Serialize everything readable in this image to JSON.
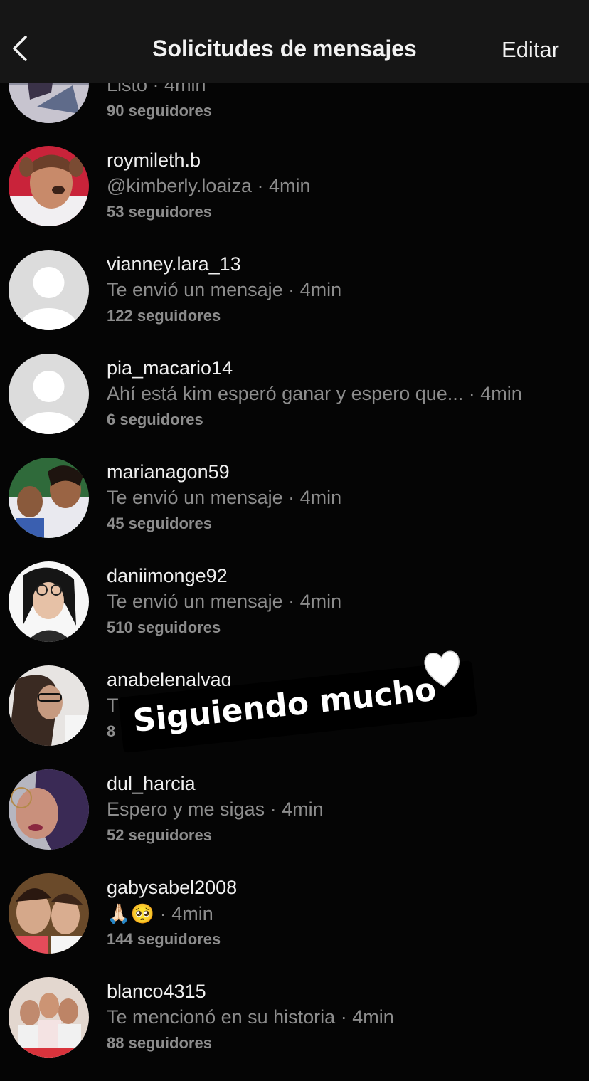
{
  "header": {
    "title": "Solicitudes de mensajes",
    "edit_label": "Editar"
  },
  "requests": [
    {
      "username": "",
      "message": "Listo",
      "time": "4min",
      "followers": "90 seguidores"
    },
    {
      "username": "roymileth.b",
      "message": "@kimberly.loaiza",
      "time": "4min",
      "followers": "53 seguidores"
    },
    {
      "username": "vianney.lara_13",
      "message": "Te envió un mensaje",
      "time": "4min",
      "followers": "122 seguidores"
    },
    {
      "username": "pia_macario14",
      "message": "Ahí está kim esperó ganar y espero que...",
      "time": "4min",
      "followers": "6 seguidores"
    },
    {
      "username": "marianagon59",
      "message": "Te envió un mensaje",
      "time": "4min",
      "followers": "45 seguidores"
    },
    {
      "username": "daniimonge92",
      "message": "Te envió un mensaje",
      "time": "4min",
      "followers": "510 seguidores"
    },
    {
      "username": "anabelenalvag",
      "message": "T",
      "time": "",
      "followers": "8"
    },
    {
      "username": "dul_harcia",
      "message": "Espero y me sigas",
      "time": "4min",
      "followers": "52 seguidores"
    },
    {
      "username": "gabysabel2008",
      "message": "🙏🏻🥺",
      "time": "4min",
      "followers": "144 seguidores"
    },
    {
      "username": "blanco4315",
      "message": "Te mencionó en su historia",
      "time": "4min",
      "followers": "88 seguidores"
    }
  ],
  "sticker": {
    "text": "Siguiendo mucho",
    "icon": "white-heart-icon"
  },
  "icons": {
    "back": "chevron-left-icon"
  },
  "colors": {
    "background": "#050505",
    "header": "#161616",
    "primary_text": "#efefef",
    "secondary_text": "#8d8d8d",
    "placeholder_avatar": "#d9d9d9"
  }
}
